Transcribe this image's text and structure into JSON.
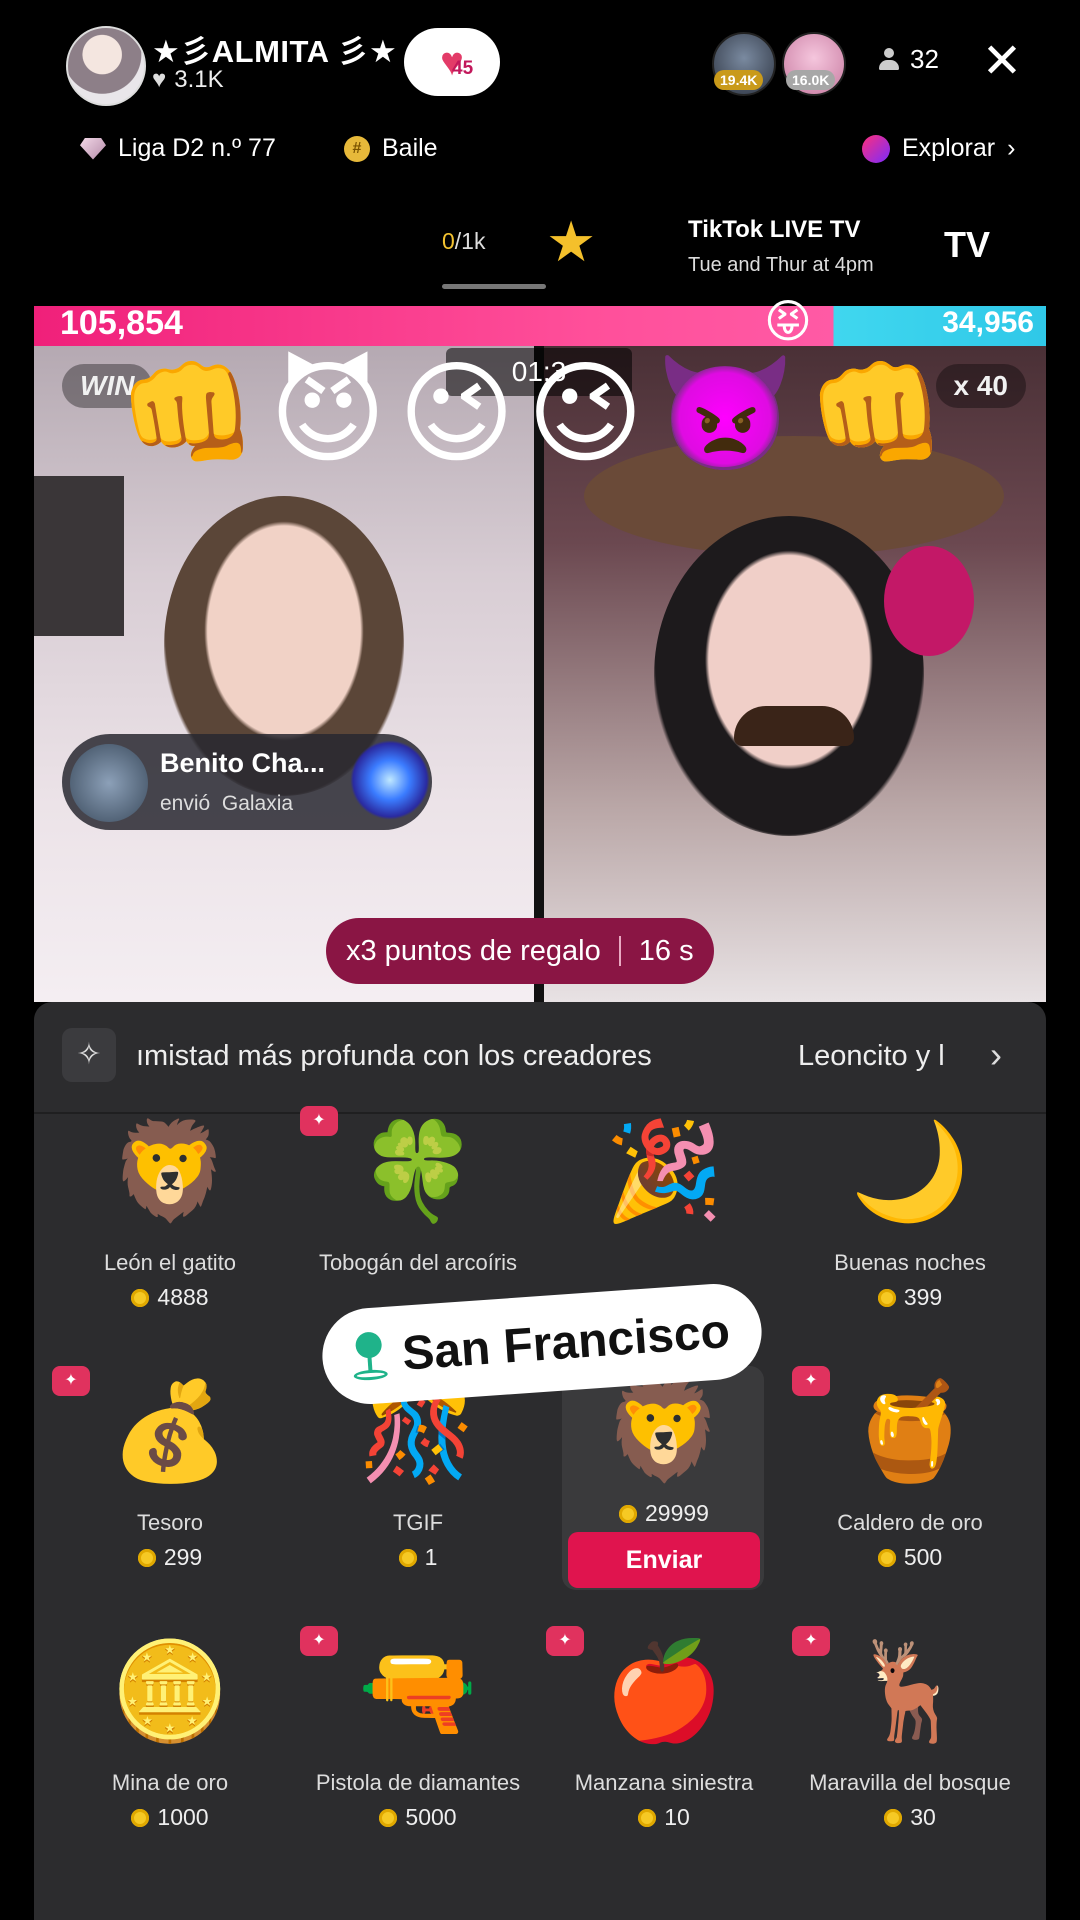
{
  "header": {
    "host_name": "★彡ALMITA 彡★",
    "host_likes": "3.1K",
    "team_level": "45",
    "viewer_badges": [
      "19.4K",
      "16.0K"
    ],
    "viewer_count": "32"
  },
  "subheader": {
    "league": "Liga D2 n.º 77",
    "category": "Baile",
    "explore": "Explorar"
  },
  "live_tv": {
    "goal_current": "0",
    "goal_total": "/1k",
    "title": "TikTok LIVE TV",
    "schedule": "Tue and Thur at 4pm",
    "logo": "TV"
  },
  "battle": {
    "score_left": "105,854",
    "score_right": "34,956",
    "win_left": "WIN",
    "win_right": "x 40",
    "timer": "01:3",
    "emojis": "👊😈😉😉👿👊"
  },
  "gift_toast": {
    "sender": "Benito Cha...",
    "action": "envió",
    "gift": "Galaxia"
  },
  "bonus": {
    "text": "x3 puntos de regalo",
    "time": "16 s"
  },
  "gift_panel": {
    "banner_text": "ımistad más profunda con los creadores",
    "banner_right": "Leoncito y l",
    "send_label": "Enviar",
    "location": "San Francisco",
    "gifts": [
      {
        "name": "León el gatito",
        "price": "4888",
        "icon": "🦁"
      },
      {
        "name": "Tobogán del arcoíris",
        "price": "",
        "icon": "🍀"
      },
      {
        "name": "",
        "price": "",
        "icon": "🎉"
      },
      {
        "name": "Buenas noches",
        "price": "399",
        "icon": "🌙"
      },
      {
        "name": "Tesoro",
        "price": "299",
        "icon": "💰"
      },
      {
        "name": "TGIF",
        "price": "1",
        "icon": "🎊"
      },
      {
        "name": "",
        "price": "29999",
        "icon": "🦁"
      },
      {
        "name": "Caldero de oro",
        "price": "500",
        "icon": "🍯"
      },
      {
        "name": "Mina de oro",
        "price": "1000",
        "icon": "🪙"
      },
      {
        "name": "Pistola de diamantes",
        "price": "5000",
        "icon": "🔫"
      },
      {
        "name": "Manzana siniestra",
        "price": "10",
        "icon": "🍎"
      },
      {
        "name": "Maravilla del bosque",
        "price": "30",
        "icon": "🦌"
      }
    ]
  }
}
